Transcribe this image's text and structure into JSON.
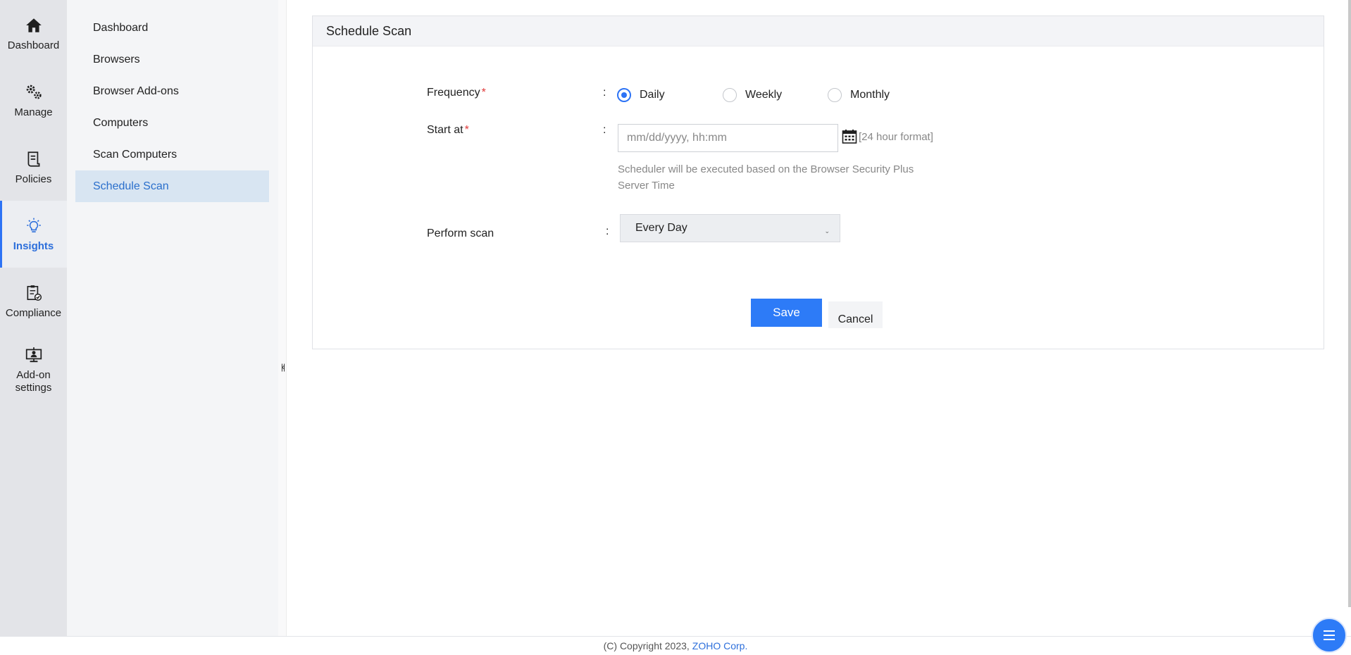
{
  "rail": {
    "items": [
      {
        "label": "Dashboard",
        "icon": "home-icon"
      },
      {
        "label": "Manage",
        "icon": "gears-icon"
      },
      {
        "label": "Policies",
        "icon": "policy-document-icon"
      },
      {
        "label": "Insights",
        "icon": "lightbulb-icon"
      },
      {
        "label": "Compliance",
        "icon": "clipboard-check-icon"
      },
      {
        "label": "Add-on settings",
        "icon": "monitor-user-icon"
      }
    ],
    "add_on_line1": "Add-on",
    "add_on_line2": "settings"
  },
  "submenu": {
    "items": [
      {
        "label": "Dashboard"
      },
      {
        "label": "Browsers"
      },
      {
        "label": "Browser Add-ons"
      },
      {
        "label": "Computers"
      },
      {
        "label": "Scan Computers"
      },
      {
        "label": "Schedule Scan"
      }
    ]
  },
  "panel": {
    "title": "Schedule Scan",
    "frequency": {
      "label": "Frequency",
      "required": "*",
      "colon": ":",
      "options": [
        {
          "label": "Daily",
          "selected": true
        },
        {
          "label": "Weekly",
          "selected": false
        },
        {
          "label": "Monthly",
          "selected": false
        }
      ]
    },
    "start_at": {
      "label": "Start at",
      "required": "*",
      "colon": ":",
      "placeholder": "mm/dd/yyyy, hh:mm",
      "format_hint": "[24 hour format]",
      "note_line1": "Scheduler will be executed based on the Browser Security Plus",
      "note_line2": "Server Time"
    },
    "perform_scan": {
      "label": "Perform scan",
      "colon": ":",
      "selected": "Every Day"
    },
    "save_label": "Save",
    "cancel_label": "Cancel"
  },
  "footer": {
    "copyright": "(C) Copyright 2023,",
    "company": "ZOHO Corp."
  },
  "colors": {
    "accent": "#2d7bf7",
    "active_text": "#2a6fcc",
    "required": "#e03a3a"
  }
}
